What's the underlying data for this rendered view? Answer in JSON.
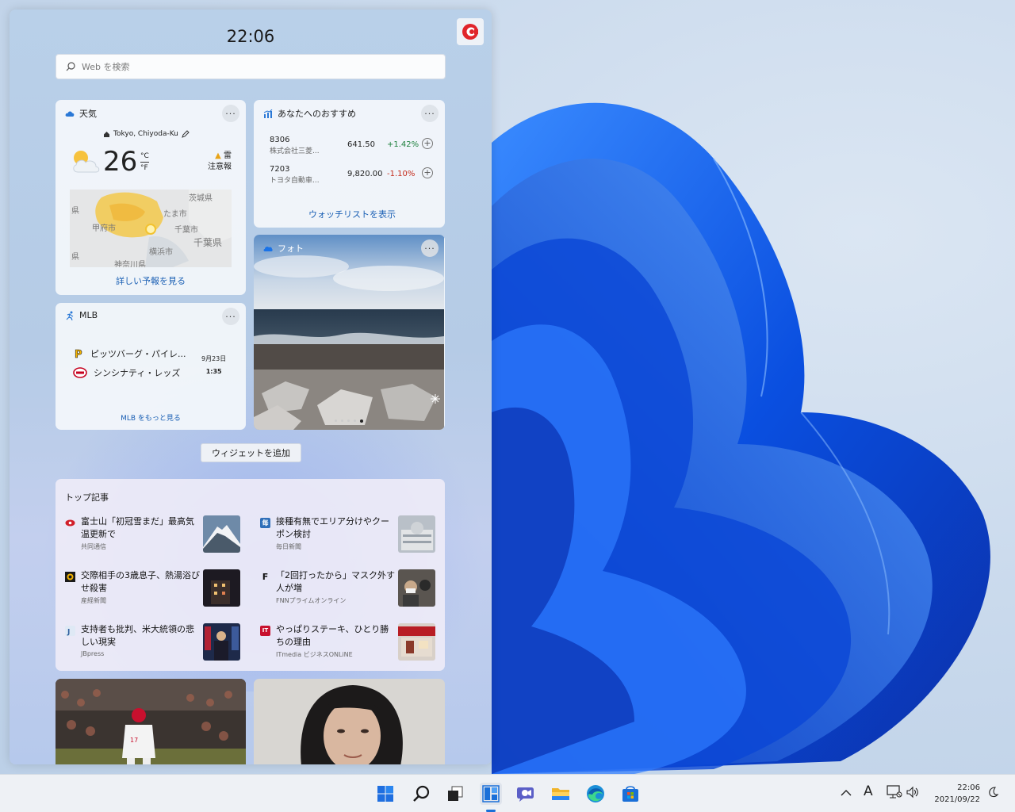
{
  "panel": {
    "time": "22:06",
    "search_placeholder": "Web を検索",
    "add_widget_label": "ウィジェットを追加"
  },
  "weather": {
    "title": "天気",
    "location": "Tokyo, Chiyoda-Ku",
    "temperature": "26",
    "unit_c": "°C",
    "unit_f": "°F",
    "alert_line1": "雷",
    "alert_line2": "注意報",
    "map_labels": [
      "茨城県",
      "たま市",
      "甲府市",
      "千葉市",
      "千葉県",
      "横浜市",
      "県",
      "県",
      "神奈川県"
    ],
    "link": "詳しい予報を見る"
  },
  "stocks": {
    "title": "あなたへのおすすめ",
    "items": [
      {
        "symbol": "8306",
        "name": "株式会社三菱...",
        "price": "641.50",
        "change": "+1.42%",
        "color": "#1b7f3b"
      },
      {
        "symbol": "7203",
        "name": "トヨタ自動車...",
        "price": "9,820.00",
        "change": "-1.10%",
        "color": "#c42b1c"
      }
    ],
    "link": "ウォッチリストを表示"
  },
  "photos": {
    "title": "フォト"
  },
  "mlb": {
    "title": "MLB",
    "team1": "ピッツバーグ・パイレ...",
    "team2": "シンシナティ・レッズ",
    "date": "9月23日",
    "time": "1:35",
    "link": "MLB をもっと見る"
  },
  "news": {
    "heading": "トップ記事",
    "items": [
      {
        "headline": "富士山「初冠雪まだ」最高気温更新で",
        "source": "共同通信",
        "logo_color": "#d11f2a",
        "logo_text": "●"
      },
      {
        "headline": "接種有無でエリア分けやクーポン検討",
        "source": "毎日新聞",
        "logo_color": "#2f6fb9",
        "logo_text": "毎"
      },
      {
        "headline": "交際相手の3歳息子、熱湯浴びせ殺害",
        "source": "産経新聞",
        "logo_color": "#1a1a1a",
        "logo_text": "産"
      },
      {
        "headline": "「2回打ったから」マスク外す人が増",
        "source": "FNNプライムオンライン",
        "logo_color": "#ffffff",
        "logo_text": "F"
      },
      {
        "headline": "支持者も批判、米大統領の悲しい現実",
        "source": "JBpress",
        "logo_color": "#4a7fbf",
        "logo_text": "J"
      },
      {
        "headline": "やっぱりステーキ、ひとり勝ちの理由",
        "source": "ITmedia ビジネスONLiNE",
        "logo_color": "#c8102e",
        "logo_text": "IT"
      }
    ]
  },
  "taskbar": {
    "clock_time": "22:06",
    "clock_date": "2021/09/22",
    "ime": "A"
  }
}
